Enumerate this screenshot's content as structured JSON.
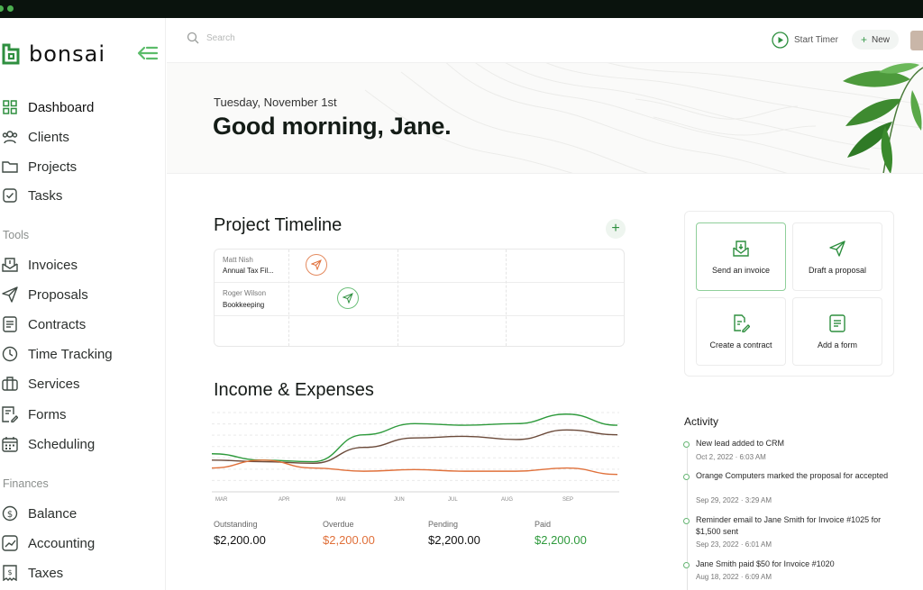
{
  "app": {
    "name": "bonsai"
  },
  "colors": {
    "accent": "#2e8f3f",
    "orange": "#e0703a",
    "brown": "#6b4a3a"
  },
  "search": {
    "placeholder": "Search"
  },
  "header": {
    "timer_label": "Start Timer",
    "new_label": "New"
  },
  "sidebar": {
    "main": [
      {
        "label": "Dashboard",
        "icon": "grid-icon"
      },
      {
        "label": "Clients",
        "icon": "people-icon"
      },
      {
        "label": "Projects",
        "icon": "folder-icon"
      },
      {
        "label": "Tasks",
        "icon": "check-square-icon"
      }
    ],
    "tools_title": "Tools",
    "tools": [
      {
        "label": "Invoices",
        "icon": "invoice-icon"
      },
      {
        "label": "Proposals",
        "icon": "send-icon"
      },
      {
        "label": "Contracts",
        "icon": "contract-icon"
      },
      {
        "label": "Time Tracking",
        "icon": "clock-icon"
      },
      {
        "label": "Services",
        "icon": "briefcase-icon"
      },
      {
        "label": "Forms",
        "icon": "form-icon"
      },
      {
        "label": "Scheduling",
        "icon": "calendar-icon"
      }
    ],
    "finances_title": "Finances",
    "finances": [
      {
        "label": "Balance",
        "icon": "dollar-icon"
      },
      {
        "label": "Accounting",
        "icon": "chart-icon"
      },
      {
        "label": "Taxes",
        "icon": "receipt-icon"
      }
    ]
  },
  "hero": {
    "date": "Tuesday, November 1st",
    "greeting": "Good morning, Jane."
  },
  "timeline": {
    "title": "Project Timeline",
    "rows": [
      {
        "name": "Matt Nish",
        "task": "Annual Tax Fil..."
      },
      {
        "name": "Roger Wilson",
        "task": "Bookkeeping"
      }
    ]
  },
  "income": {
    "title": "Income & Expenses",
    "stats": [
      {
        "label": "Outstanding",
        "value": "$2,200.00",
        "color": "#111111"
      },
      {
        "label": "Overdue",
        "value": "$2,200.00",
        "color": "#e0703a"
      },
      {
        "label": "Pending",
        "value": "$2,200.00",
        "color": "#111111"
      },
      {
        "label": "Paid",
        "value": "$2,200.00",
        "color": "#2e9a3c"
      }
    ]
  },
  "chart_data": {
    "type": "line",
    "categories": [
      "MAR",
      "APR",
      "MAI",
      "JUN",
      "JUL",
      "AUG",
      "SEP"
    ],
    "series": [
      {
        "color": "#2e9a3c",
        "values": [
          48,
          40,
          38,
          72,
          86,
          84,
          86,
          98,
          84
        ]
      },
      {
        "color": "#6b4a3a",
        "values": [
          40,
          38,
          36,
          56,
          68,
          70,
          66,
          78,
          72
        ]
      },
      {
        "color": "#e0703a",
        "values": [
          30,
          40,
          30,
          26,
          28,
          26,
          26,
          30,
          22
        ]
      }
    ],
    "grid": true
  },
  "actions": [
    {
      "label": "Send an invoice",
      "icon": "invoice-send-icon"
    },
    {
      "label": "Draft a proposal",
      "icon": "paper-plane-icon"
    },
    {
      "label": "Create a contract",
      "icon": "contract-edit-icon"
    },
    {
      "label": "Add a form",
      "icon": "form-add-icon"
    }
  ],
  "activity": {
    "title": "Activity",
    "items": [
      {
        "text": "New lead added to CRM",
        "time": "Oct 2, 2022  ·  6:03 AM"
      },
      {
        "text": "Orange Computers marked the proposal for accepted",
        "time": "Sep 29, 2022  ·  3:29 AM"
      },
      {
        "text": "Reminder email to Jane Smith for Invoice #1025 for $1,500 sent",
        "time": "Sep 23, 2022  ·  6:01 AM"
      },
      {
        "text": "Jane Smith paid $50 for Invoice #1020",
        "time": "Aug 18, 2022  ·  6:09 AM"
      }
    ]
  }
}
